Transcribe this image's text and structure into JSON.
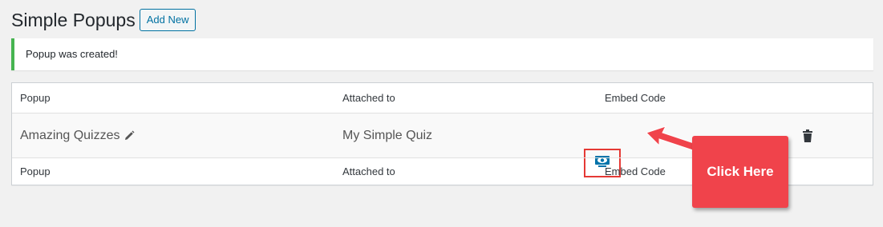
{
  "header": {
    "title": "Simple Popups",
    "add_new_label": "Add New"
  },
  "notice": {
    "message": "Popup was created!",
    "color": "#46b450"
  },
  "table": {
    "columns": [
      "Popup",
      "Attached to",
      "Embed Code"
    ],
    "footer_columns": [
      "Popup",
      "Attached to",
      "Embed Code"
    ],
    "rows": [
      {
        "popup": "Amazing Quizzes",
        "attached_to": "My Simple Quiz",
        "embed_icon": "view-embed-icon",
        "delete_icon": "trash-icon"
      }
    ]
  },
  "callout": {
    "text": "Click Here",
    "color": "#f0434b"
  },
  "colors": {
    "accent": "#0071a1",
    "highlight": "#e53935"
  }
}
